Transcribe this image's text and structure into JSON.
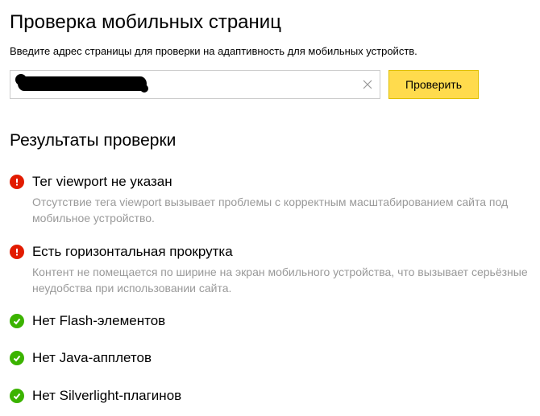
{
  "page": {
    "title": "Проверка мобильных страниц",
    "subtitle": "Введите адрес страницы для проверки на адаптивность для мобильных устройств."
  },
  "form": {
    "url_value": "",
    "check_label": "Проверить"
  },
  "results": {
    "heading": "Результаты проверки",
    "items": [
      {
        "status": "error",
        "title": "Тег viewport не указан",
        "desc": "Отсутствие тега viewport вызывает проблемы с корректным масштабированием сайта под мобильное устройство."
      },
      {
        "status": "error",
        "title": "Есть горизонтальная прокрутка",
        "desc": "Контент не помещается по ширине на экран мобильного устройства, что вызывает серьёзные неудобства при использовании сайта."
      },
      {
        "status": "ok",
        "title": "Нет Flash-элементов",
        "desc": ""
      },
      {
        "status": "ok",
        "title": "Нет Java-апплетов",
        "desc": ""
      },
      {
        "status": "ok",
        "title": "Нет Silverlight-плагинов",
        "desc": ""
      }
    ]
  }
}
